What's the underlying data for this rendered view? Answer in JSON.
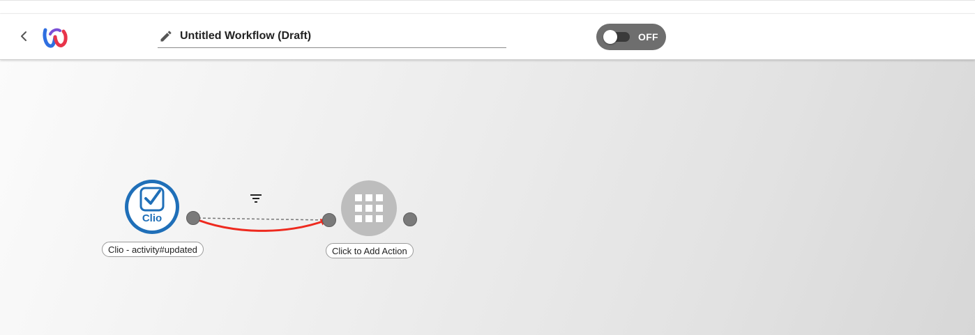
{
  "header": {
    "back_icon": "chevron-left-icon",
    "logo_icon": "w-logo-icon",
    "edit_icon": "pencil-icon",
    "workflow_title": "Untitled Workflow (Draft)",
    "toggle": {
      "label": "OFF",
      "state": "off"
    }
  },
  "canvas": {
    "trigger_node": {
      "icon": "clio-logo-icon",
      "logo_text": "Clio",
      "label": "Clio - activity#updated"
    },
    "filter_icon": "filter-icon",
    "action_node": {
      "icon": "app-grid-icon",
      "label": "Click to Add Action"
    },
    "annotation_arrow_color": "#ee2a1f"
  },
  "colors": {
    "clio_blue": "#1f6fb8",
    "toggle_bg": "#6e6e6e",
    "action_node": "#bdbdbd",
    "port": "#7a7a7a"
  }
}
